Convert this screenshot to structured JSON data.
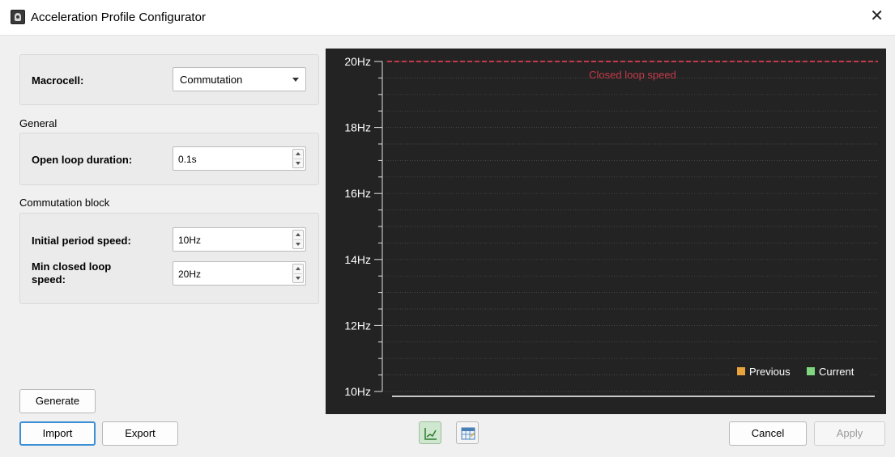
{
  "window": {
    "title": "Acceleration Profile Configurator",
    "close_glyph": "✕",
    "app_icon": "app-logo-icon"
  },
  "macrocell": {
    "label": "Macrocell:",
    "value": "Commutation"
  },
  "general": {
    "heading": "General",
    "open_loop_duration": {
      "label": "Open loop duration:",
      "value": "0.1s"
    }
  },
  "commutation_block": {
    "heading": "Commutation block",
    "initial_period_speed": {
      "label": "Initial period speed:",
      "value": "10Hz"
    },
    "min_closed_loop_speed": {
      "label_line1": "Min closed loop",
      "label_line2": "speed:",
      "value": "20Hz"
    }
  },
  "buttons": {
    "generate": "Generate",
    "import": "Import",
    "export": "Export",
    "cancel": "Cancel",
    "apply": "Apply"
  },
  "view_toggle": {
    "chart_view_icon": "line-chart-icon",
    "table_view_icon": "table-calendar-icon",
    "active": "chart"
  },
  "chart_data": {
    "type": "line",
    "title": "",
    "xlabel": "",
    "ylabel": "",
    "ylim": [
      10,
      20
    ],
    "y_ticks": [
      "10Hz",
      "12Hz",
      "14Hz",
      "16Hz",
      "18Hz",
      "20Hz"
    ],
    "background": "#232323",
    "grid": true,
    "legend_position": "bottom-right",
    "legend": [
      {
        "name": "Previous",
        "color": "#e8a33d"
      },
      {
        "name": "Current",
        "color": "#7fd67f"
      }
    ],
    "series": [
      {
        "name": "Current",
        "color": "#ffffff",
        "points": [
          [
            0,
            10
          ],
          [
            1,
            10
          ]
        ]
      }
    ],
    "reference_lines": [
      {
        "label": "Closed loop speed",
        "y": 20,
        "color": "#c43a4a",
        "style": "dashed"
      }
    ]
  }
}
